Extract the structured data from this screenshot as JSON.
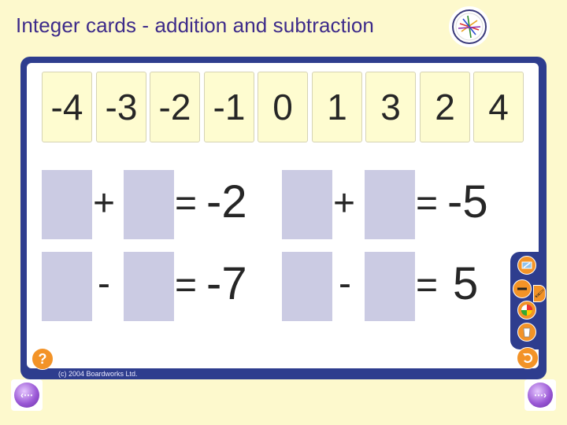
{
  "header": {
    "title": "Integer cards - addition and subtraction"
  },
  "cards": [
    "-4",
    "-3",
    "-2",
    "-1",
    "0",
    "1",
    "3",
    "2",
    "4"
  ],
  "equations": [
    {
      "operator": "+",
      "equals": "=",
      "result": "-2"
    },
    {
      "operator": "+",
      "equals": "=",
      "result": "-5"
    },
    {
      "operator": "-",
      "equals": "=",
      "result": "-7"
    },
    {
      "operator": "-",
      "equals": "=",
      "result": "5"
    }
  ],
  "footer": {
    "help_label": "?",
    "copyright": "(c) 2004 Boardworks Ltd."
  },
  "colors": {
    "frame": "#2e3d8e",
    "accent": "#f39327",
    "card": "#fefcd0",
    "slot": "#cbcbe3",
    "title": "#3d2b8a"
  }
}
